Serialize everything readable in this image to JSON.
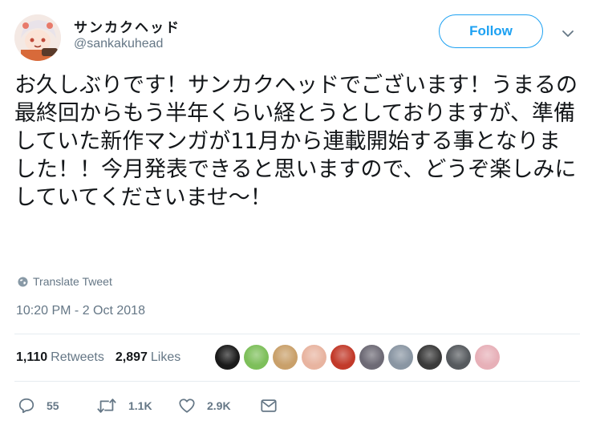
{
  "author": {
    "display_name": "サンカクヘッド",
    "handle": "@sankakuhead"
  },
  "follow_button": {
    "label": "Follow"
  },
  "tweet": {
    "text": "お久しぶりです！サンカクヘッドでございます！うまるの最終回からもう半年くらい経とうとしておりますが、準備していた新作マンガが11月から連載開始する事となりました！！今月発表できると思いますので、どうぞ楽しみにしていてくださいませ〜！",
    "translate_label": "Translate Tweet",
    "timestamp": "10:20 PM - 2 Oct 2018"
  },
  "stats": {
    "retweets_count": "1,110",
    "retweets_label": "Retweets",
    "likes_count": "2,897",
    "likes_label": "Likes"
  },
  "liker_avatars": [
    {
      "name": "liker-avatar-1",
      "color": "#1a1a1a"
    },
    {
      "name": "liker-avatar-2",
      "color": "#7dbf5a"
    },
    {
      "name": "liker-avatar-3",
      "color": "#c9a06a"
    },
    {
      "name": "liker-avatar-4",
      "color": "#e8b4a0"
    },
    {
      "name": "liker-avatar-5",
      "color": "#c23a2a"
    },
    {
      "name": "liker-avatar-6",
      "color": "#6d6a75"
    },
    {
      "name": "liker-avatar-7",
      "color": "#8a96a3"
    },
    {
      "name": "liker-avatar-8",
      "color": "#3a3a3a"
    },
    {
      "name": "liker-avatar-9",
      "color": "#565a5e"
    },
    {
      "name": "liker-avatar-10",
      "color": "#e7b0b8"
    }
  ],
  "actions": {
    "reply_count": "55",
    "retweet_count": "1.1K",
    "like_count": "2.9K"
  },
  "colors": {
    "accent": "#1da1f2",
    "text": "#14171a",
    "muted": "#657786",
    "divider": "#e6ecf0"
  }
}
